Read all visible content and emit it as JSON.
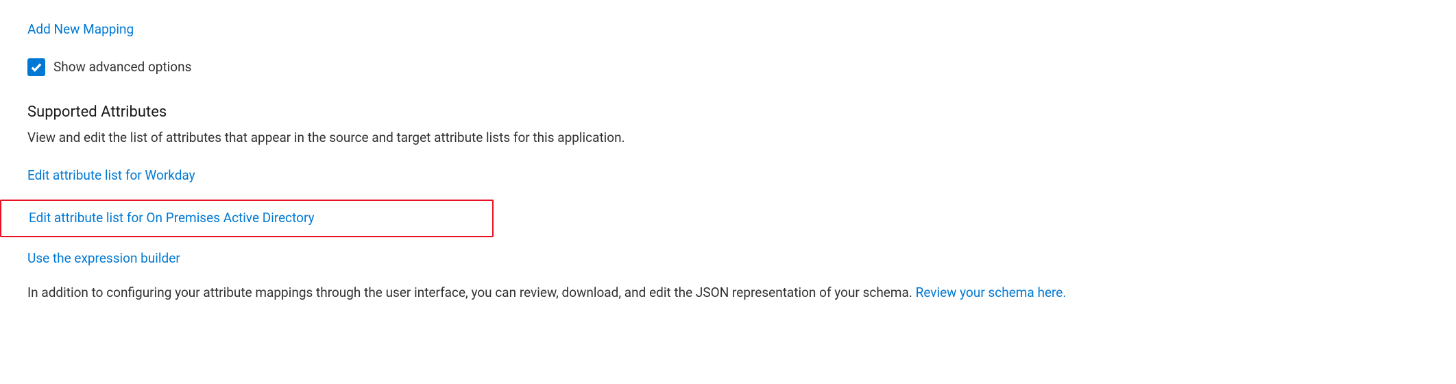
{
  "addMappingLink": "Add New Mapping",
  "advancedOptionsLabel": "Show advanced options",
  "supportedAttributes": {
    "heading": "Supported Attributes",
    "description": "View and edit the list of attributes that appear in the source and target attribute lists for this application."
  },
  "links": {
    "editWorkday": "Edit attribute list for Workday",
    "editOnPrem": "Edit attribute list for On Premises Active Directory",
    "expressionBuilder": "Use the expression builder"
  },
  "jsonParagraph": {
    "text": "In addition to configuring your attribute mappings through the user interface, you can review, download, and edit the JSON representation of your schema. ",
    "linkText": "Review your schema here."
  }
}
